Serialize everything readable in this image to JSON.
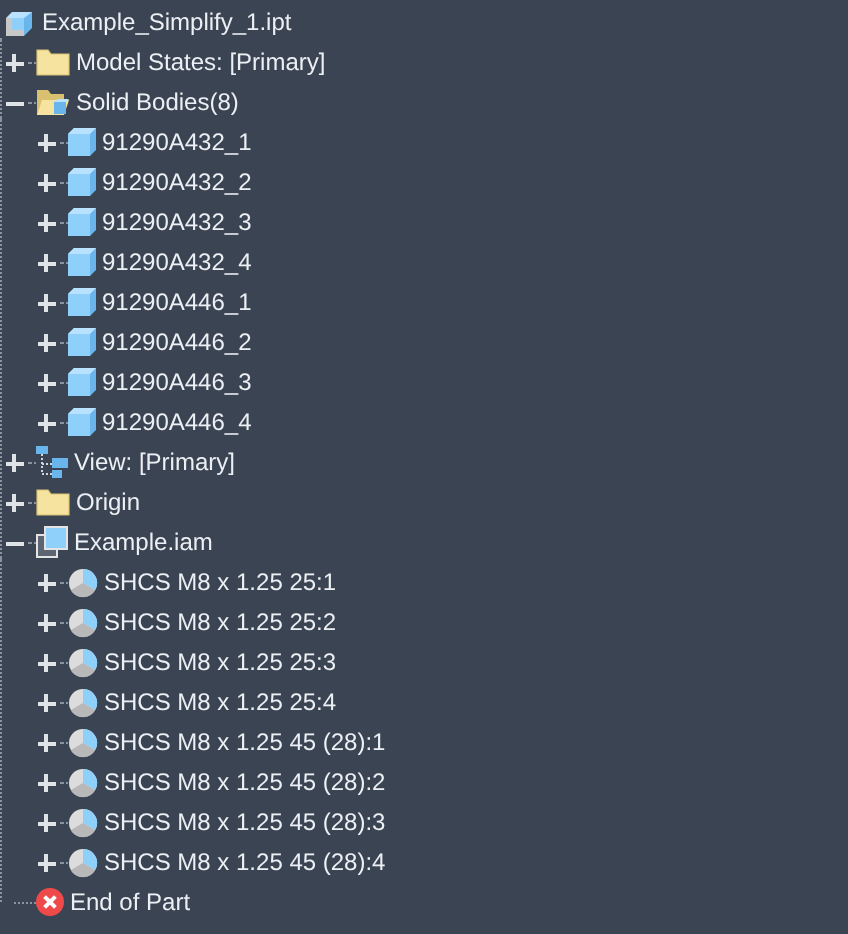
{
  "tree": {
    "label": "Example_Simplify_1.ipt",
    "kind": "part",
    "children": [
      {
        "label": "Model States: [Primary]",
        "kind": "folder",
        "expanded": false
      },
      {
        "label": "Solid Bodies(8)",
        "kind": "folder-open",
        "expanded": true,
        "children": [
          {
            "label": "91290A432_1",
            "kind": "body",
            "expanded": false
          },
          {
            "label": "91290A432_2",
            "kind": "body",
            "expanded": false
          },
          {
            "label": "91290A432_3",
            "kind": "body",
            "expanded": false
          },
          {
            "label": "91290A432_4",
            "kind": "body",
            "expanded": false
          },
          {
            "label": "91290A446_1",
            "kind": "body",
            "expanded": false
          },
          {
            "label": "91290A446_2",
            "kind": "body",
            "expanded": false
          },
          {
            "label": "91290A446_3",
            "kind": "body",
            "expanded": false
          },
          {
            "label": "91290A446_4",
            "kind": "body",
            "expanded": false
          }
        ]
      },
      {
        "label": "View: [Primary]",
        "kind": "view",
        "expanded": false
      },
      {
        "label": "Origin",
        "kind": "folder",
        "expanded": false
      },
      {
        "label": "Example.iam",
        "kind": "assembly",
        "expanded": true,
        "children": [
          {
            "label": "SHCS M8 x 1.25 25:1",
            "kind": "component",
            "expanded": false
          },
          {
            "label": "SHCS M8 x 1.25 25:2",
            "kind": "component",
            "expanded": false
          },
          {
            "label": "SHCS M8 x 1.25 25:3",
            "kind": "component",
            "expanded": false
          },
          {
            "label": "SHCS M8 x 1.25 25:4",
            "kind": "component",
            "expanded": false
          },
          {
            "label": "SHCS M8 x 1.25 45 (28):1",
            "kind": "component",
            "expanded": false
          },
          {
            "label": "SHCS M8 x 1.25 45 (28):2",
            "kind": "component",
            "expanded": false
          },
          {
            "label": "SHCS M8 x 1.25 45 (28):3",
            "kind": "component",
            "expanded": false
          },
          {
            "label": "SHCS M8 x 1.25 45 (28):4",
            "kind": "component",
            "expanded": false
          }
        ]
      },
      {
        "label": "End of Part",
        "kind": "end"
      }
    ]
  }
}
